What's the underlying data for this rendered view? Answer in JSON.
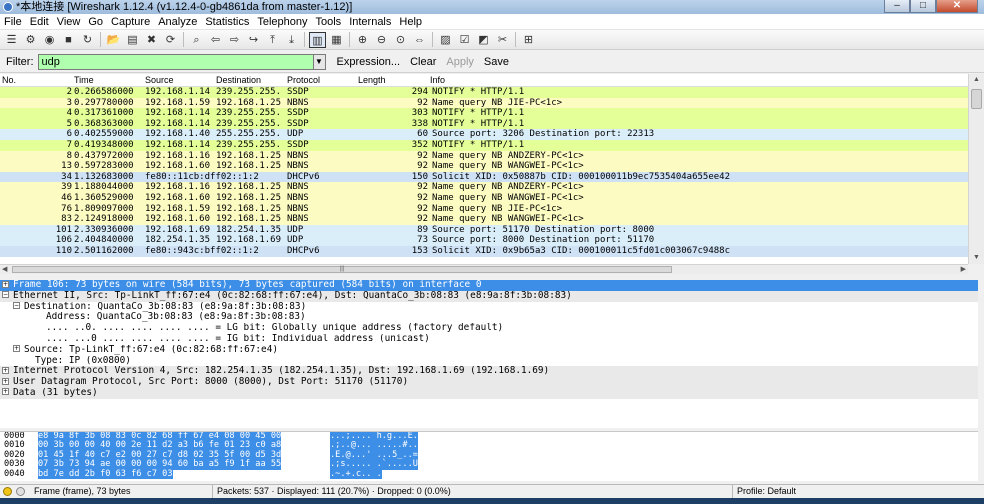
{
  "window": {
    "title": "*本地连接   [Wireshark 1.12.4  (v1.12.4-0-gb4861da from master-1.12)]",
    "minimize": "–",
    "maximize": "□",
    "close": "✕"
  },
  "menu": [
    "File",
    "Edit",
    "View",
    "Go",
    "Capture",
    "Analyze",
    "Statistics",
    "Telephony",
    "Tools",
    "Internals",
    "Help"
  ],
  "toolbar": [
    "interfaces-icon",
    "options-icon",
    "start-icon",
    "stop-icon",
    "restart-icon",
    "sep",
    "open-icon",
    "save-icon",
    "close-file-icon",
    "reload-icon",
    "sep",
    "find-icon",
    "back-icon",
    "forward-icon",
    "goto-icon",
    "first-icon",
    "last-icon",
    "sep",
    "colorize-icon",
    "autoscroll-icon",
    "sep",
    "zoom-in-icon",
    "zoom-out-icon",
    "normal-size-icon",
    "resize-columns-icon",
    "sep",
    "capture-filters-icon",
    "display-filters-icon",
    "coloring-rules-icon",
    "preferences-icon",
    "sep",
    "help-icon"
  ],
  "filter": {
    "label": "Filter:",
    "value": "udp",
    "expression": "Expression...",
    "clear": "Clear",
    "apply": "Apply",
    "save": "Save"
  },
  "columns": [
    "No.",
    "Time",
    "Source",
    "Destination",
    "Protocol",
    "Length",
    "Info"
  ],
  "packets": [
    {
      "no": "2",
      "time": "0.266586000",
      "src": "192.168.1.14",
      "dst": "239.255.255.",
      "proto": "SSDP",
      "len": "294",
      "info": "NOTIFY * HTTP/1.1",
      "color": "c-ssdp"
    },
    {
      "no": "3",
      "time": "0.297780000",
      "src": "192.168.1.59",
      "dst": "192.168.1.25",
      "proto": "NBNS",
      "len": "92",
      "info": "Name query NB JIE-PC<1c>",
      "color": "c-nbns"
    },
    {
      "no": "4",
      "time": "0.317361000",
      "src": "192.168.1.14",
      "dst": "239.255.255.",
      "proto": "SSDP",
      "len": "303",
      "info": "NOTIFY * HTTP/1.1",
      "color": "c-ssdp"
    },
    {
      "no": "5",
      "time": "0.368363000",
      "src": "192.168.1.14",
      "dst": "239.255.255.",
      "proto": "SSDP",
      "len": "338",
      "info": "NOTIFY * HTTP/1.1",
      "color": "c-ssdp"
    },
    {
      "no": "6",
      "time": "0.402559000",
      "src": "192.168.1.40",
      "dst": "255.255.255.",
      "proto": "UDP",
      "len": "60",
      "info": "Source port: 3206  Destination port: 22313",
      "color": "c-udp"
    },
    {
      "no": "7",
      "time": "0.419348000",
      "src": "192.168.1.14",
      "dst": "239.255.255.",
      "proto": "SSDP",
      "len": "352",
      "info": "NOTIFY * HTTP/1.1",
      "color": "c-ssdp"
    },
    {
      "no": "8",
      "time": "0.437972000",
      "src": "192.168.1.16",
      "dst": "192.168.1.25",
      "proto": "NBNS",
      "len": "92",
      "info": "Name query NB ANDZERY-PC<1c>",
      "color": "c-nbns"
    },
    {
      "no": "13",
      "time": "0.597283000",
      "src": "192.168.1.60",
      "dst": "192.168.1.25",
      "proto": "NBNS",
      "len": "92",
      "info": "Name query NB WANGWEI-PC<1c>",
      "color": "c-nbns"
    },
    {
      "no": "34",
      "time": "1.132683000",
      "src": "fe80::11cb:dff02::1:2",
      "dst": "",
      "proto": "DHCPv6",
      "len": "150",
      "info": "Solicit XID: 0x50887b CID: 000100011b9ec7535404a655ee42",
      "color": "c-dhcp"
    },
    {
      "no": "39",
      "time": "1.188044000",
      "src": "192.168.1.16",
      "dst": "192.168.1.25",
      "proto": "NBNS",
      "len": "92",
      "info": "Name query NB ANDZERY-PC<1c>",
      "color": "c-nbns"
    },
    {
      "no": "46",
      "time": "1.360529000",
      "src": "192.168.1.60",
      "dst": "192.168.1.25",
      "proto": "NBNS",
      "len": "92",
      "info": "Name query NB WANGWEI-PC<1c>",
      "color": "c-nbns"
    },
    {
      "no": "76",
      "time": "1.809097000",
      "src": "192.168.1.59",
      "dst": "192.168.1.25",
      "proto": "NBNS",
      "len": "92",
      "info": "Name query NB JIE-PC<1c>",
      "color": "c-nbns"
    },
    {
      "no": "83",
      "time": "2.124918000",
      "src": "192.168.1.60",
      "dst": "192.168.1.25",
      "proto": "NBNS",
      "len": "92",
      "info": "Name query NB WANGWEI-PC<1c>",
      "color": "c-nbns"
    },
    {
      "no": "101",
      "time": "2.330936000",
      "src": "192.168.1.69",
      "dst": "182.254.1.35",
      "proto": "UDP",
      "len": "89",
      "info": "Source port: 51170  Destination port: 8000",
      "color": "c-udp"
    },
    {
      "no": "106",
      "time": "2.404840000",
      "src": "182.254.1.35",
      "dst": "192.168.1.69",
      "proto": "UDP",
      "len": "73",
      "info": "Source port: 8000  Destination port: 51170",
      "color": "c-udp"
    },
    {
      "no": "110",
      "time": "2.501162000",
      "src": "fe80::943c:bff02::1:2",
      "dst": "",
      "proto": "DHCPv6",
      "len": "153",
      "info": "Solicit XID: 0x9b65a3 CID: 000100011c5fd01c003067c9488c",
      "color": "c-dhcp"
    }
  ],
  "details": [
    {
      "text": "Frame 106: 73 bytes on wire (584 bits), 73 bytes captured (584 bits) on interface 0",
      "exp": "+",
      "cls": "d-sel",
      "indent": 0
    },
    {
      "text": "Ethernet II, Src: Tp-LinkT_ff:67:e4 (0c:82:68:ff:67:e4), Dst: QuantaCo_3b:08:83 (e8:9a:8f:3b:08:83)",
      "exp": "−",
      "cls": "d-top",
      "indent": 0
    },
    {
      "text": "Destination: QuantaCo_3b:08:83 (e8:9a:8f:3b:08:83)",
      "exp": "−",
      "cls": "",
      "indent": 1
    },
    {
      "text": "Address: QuantaCo_3b:08:83 (e8:9a:8f:3b:08:83)",
      "exp": "",
      "cls": "",
      "indent": 3
    },
    {
      "text": ".... ..0. .... .... .... .... = LG bit: Globally unique address (factory default)",
      "exp": "",
      "cls": "",
      "indent": 3
    },
    {
      "text": ".... ...0 .... .... .... .... = IG bit: Individual address (unicast)",
      "exp": "",
      "cls": "",
      "indent": 3
    },
    {
      "text": "Source: Tp-LinkT_ff:67:e4 (0c:82:68:ff:67:e4)",
      "exp": "+",
      "cls": "",
      "indent": 1
    },
    {
      "text": "Type: IP (0x0800)",
      "exp": "",
      "cls": "",
      "indent": 2
    },
    {
      "text": "Internet Protocol Version 4, Src: 182.254.1.35 (182.254.1.35), Dst: 192.168.1.69 (192.168.1.69)",
      "exp": "+",
      "cls": "d-top",
      "indent": 0
    },
    {
      "text": "User Datagram Protocol, Src Port: 8000 (8000), Dst Port: 51170 (51170)",
      "exp": "+",
      "cls": "d-top",
      "indent": 0
    },
    {
      "text": "Data (31 bytes)",
      "exp": "+",
      "cls": "d-top",
      "indent": 0
    }
  ],
  "hex": [
    {
      "off": "0000",
      "bytes": "e8 9a 8f 3b 08 83 0c 82  68 ff 67 e4 08 00 45 00",
      "ascii": "...;.... h.g...E."
    },
    {
      "off": "0010",
      "bytes": "00 3b 00 00 40 00 2e 11  d2 a3 b6 fe 01 23 c0 a8",
      "ascii": ".;..@... .....#.."
    },
    {
      "off": "0020",
      "bytes": "01 45 1f 40 c7 e2 00 27  c7 d8 02 35 5f 00 d5 3d",
      "ascii": ".E.@...' ...5_..="
    },
    {
      "off": "0030",
      "bytes": "07 3b 73 94 ae 00 00 00  94 60 ba a5 f9 1f aa 55",
      "ascii": ".;s..... .`.....U"
    },
    {
      "off": "0040",
      "bytes": "bd 7e dd 2b f0 63 f6 c7  03",
      "ascii": ".~.+.c.. ."
    }
  ],
  "status": {
    "frame": "Frame (frame), 73 bytes",
    "packets": "Packets: 537 · Displayed: 111 (20.7%) · Dropped: 0 (0.0%)",
    "profile": "Profile: Default"
  }
}
